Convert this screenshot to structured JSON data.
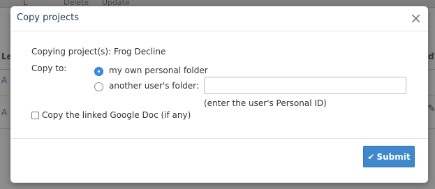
{
  "dialog": {
    "title": "Copy projects",
    "close_label": "×",
    "copying_label": "Copying project(s):",
    "project_name": "Frog Decline",
    "copy_to_label": "Copy to:",
    "option_own": "my own personal folder",
    "option_other": "another user's folder:",
    "user_id_value": "",
    "user_id_hint": "(enter the user's Personal ID)",
    "copy_doc_label": "Copy the linked Google Doc (if any)",
    "submit_label": "Submit",
    "selected_option": "own",
    "copy_doc_checked": false
  },
  "background": {
    "toolbar_items": [
      "L",
      "Delete",
      "Update"
    ],
    "row_links": [
      "A",
      "A"
    ],
    "col_header_left": "Le",
    "col_header_right": "d?"
  },
  "colors": {
    "accent": "#3b8ee8",
    "submit": "#3f88cc",
    "overlay": "#8d8d8d"
  }
}
